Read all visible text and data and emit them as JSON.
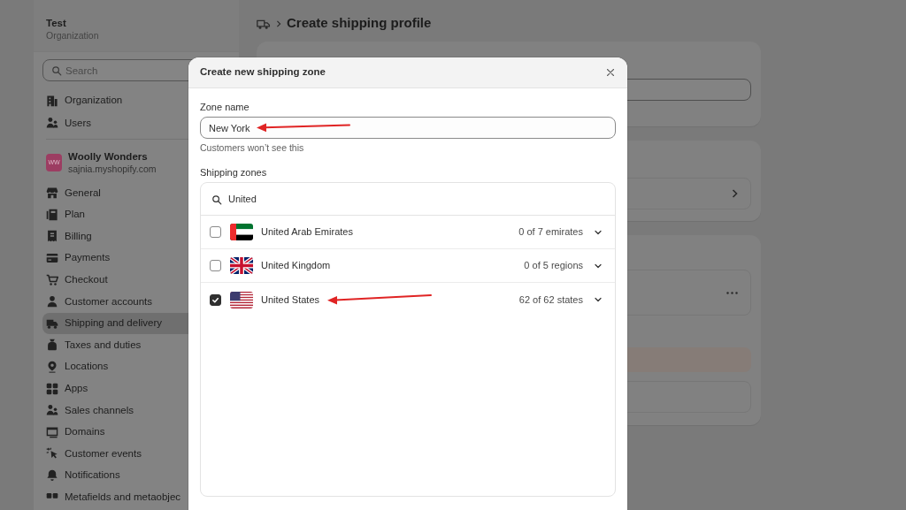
{
  "sidebar": {
    "organization": {
      "name": "Test",
      "subtitle": "Organization"
    },
    "search": {
      "placeholder": "Search"
    },
    "top_items": [
      {
        "label": "Organization",
        "selected": false
      },
      {
        "label": "Users",
        "selected": false
      }
    ],
    "store": {
      "initials": "WW",
      "name": "Woolly Wonders",
      "domain": "sajnia.myshopify.com"
    },
    "items": [
      {
        "label": "General",
        "selected": false
      },
      {
        "label": "Plan",
        "selected": false
      },
      {
        "label": "Billing",
        "selected": false
      },
      {
        "label": "Payments",
        "selected": false
      },
      {
        "label": "Checkout",
        "selected": false
      },
      {
        "label": "Customer accounts",
        "selected": false
      },
      {
        "label": "Shipping and delivery",
        "selected": true
      },
      {
        "label": "Taxes and duties",
        "selected": false
      },
      {
        "label": "Locations",
        "selected": false
      },
      {
        "label": "Apps",
        "selected": false
      },
      {
        "label": "Sales channels",
        "selected": false
      },
      {
        "label": "Domains",
        "selected": false
      },
      {
        "label": "Customer events",
        "selected": false
      },
      {
        "label": "Notifications",
        "selected": false
      },
      {
        "label": "Metafields and metaobjec",
        "selected": false
      }
    ]
  },
  "page": {
    "title": "Create shipping profile"
  },
  "modal": {
    "title": "Create new shipping zone",
    "zone_name": {
      "label": "Zone name",
      "value": "New York",
      "help": "Customers won’t see this"
    },
    "zones": {
      "label": "Shipping zones",
      "search": {
        "value": "United"
      },
      "rows": [
        {
          "name": "United Arab Emirates",
          "count": "0 of 7 emirates",
          "checked": false
        },
        {
          "name": "United Kingdom",
          "count": "0 of 5 regions",
          "checked": false
        },
        {
          "name": "United States",
          "count": "62 of 62 states",
          "checked": true
        }
      ]
    }
  }
}
